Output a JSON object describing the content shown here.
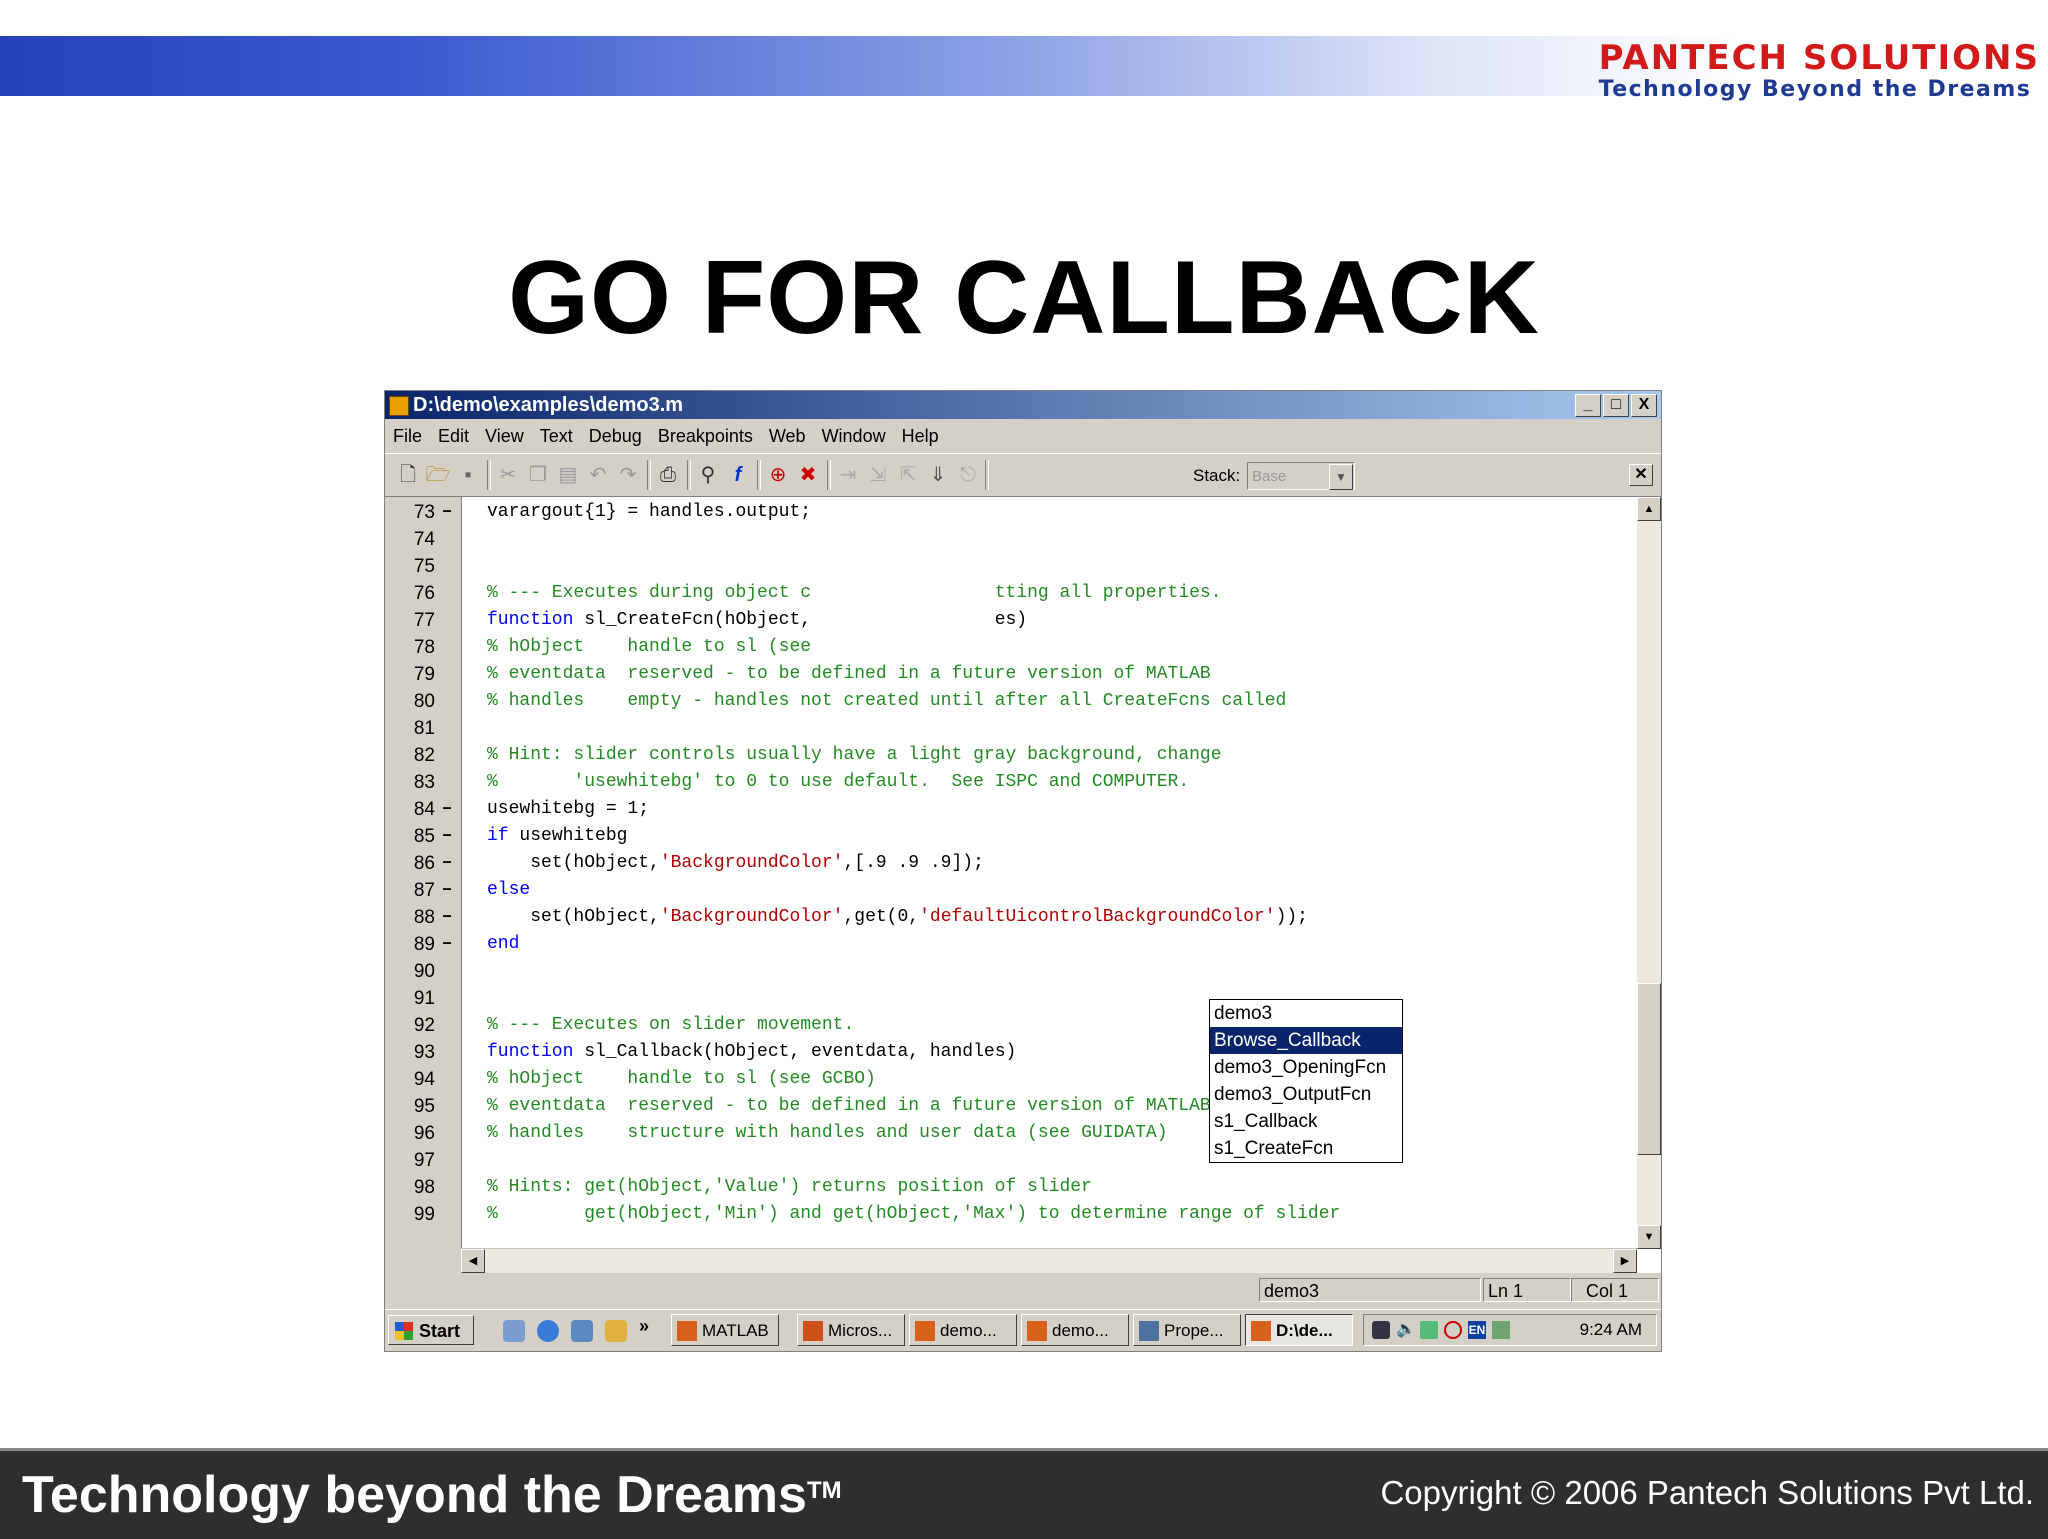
{
  "header": {
    "brand": "PANTECH SOLUTIONS",
    "tagline": "Technology Beyond the Dreams"
  },
  "slide_title": "GO FOR CALLBACK",
  "window": {
    "title": "D:\\demo\\examples\\demo3.m",
    "buttons": [
      "_",
      "□",
      "X"
    ]
  },
  "menu": [
    "File",
    "Edit",
    "View",
    "Text",
    "Debug",
    "Breakpoints",
    "Web",
    "Window",
    "Help"
  ],
  "toolbar": {
    "stack_label": "Stack:",
    "stack_value": "Base",
    "icons": [
      "new-file-icon",
      "open-icon",
      "save-icon",
      "cut-icon",
      "copy-icon",
      "paste-icon",
      "undo-icon",
      "redo-icon",
      "print-icon",
      "find-icon",
      "function-icon",
      "set-breakpoint-icon",
      "clear-breakpoint-icon",
      "step-icon",
      "step-in-icon",
      "step-out-icon",
      "continue-icon",
      "exit-debug-icon"
    ]
  },
  "code_lines": [
    {
      "n": "73",
      "bp": "–",
      "parts": [
        {
          "t": "varargout{1} = handles.output;",
          "c": ""
        }
      ]
    },
    {
      "n": "74",
      "bp": "",
      "parts": []
    },
    {
      "n": "75",
      "bp": "",
      "parts": []
    },
    {
      "n": "76",
      "bp": "",
      "parts": [
        {
          "t": "% --- Executes during object c",
          "c": "cm"
        },
        {
          "t": "                 ",
          "c": ""
        },
        {
          "t": "tting all properties.",
          "c": "cm"
        }
      ]
    },
    {
      "n": "77",
      "bp": "",
      "parts": [
        {
          "t": "function",
          "c": "kw"
        },
        {
          "t": " sl_CreateFcn(hObject,",
          "c": ""
        },
        {
          "t": "                 ",
          "c": ""
        },
        {
          "t": "es)",
          "c": ""
        }
      ]
    },
    {
      "n": "78",
      "bp": "",
      "parts": [
        {
          "t": "% hObject    handle to sl (see",
          "c": "cm"
        }
      ]
    },
    {
      "n": "79",
      "bp": "",
      "parts": [
        {
          "t": "% eventdata  reserved - to be defined in a future version of MATLAB",
          "c": "cm"
        }
      ]
    },
    {
      "n": "80",
      "bp": "",
      "parts": [
        {
          "t": "% handles    empty - handles not created until after all CreateFcns called",
          "c": "cm"
        }
      ]
    },
    {
      "n": "81",
      "bp": "",
      "parts": []
    },
    {
      "n": "82",
      "bp": "",
      "parts": [
        {
          "t": "% Hint: slider controls usually have a light gray background, change",
          "c": "cm"
        }
      ]
    },
    {
      "n": "83",
      "bp": "",
      "parts": [
        {
          "t": "%       'usewhitebg' to 0 to use default.  See ISPC and COMPUTER.",
          "c": "cm"
        }
      ]
    },
    {
      "n": "84",
      "bp": "–",
      "parts": [
        {
          "t": "usewhitebg = 1;",
          "c": ""
        }
      ]
    },
    {
      "n": "85",
      "bp": "–",
      "parts": [
        {
          "t": "if",
          "c": "kw"
        },
        {
          "t": " usewhitebg",
          "c": ""
        }
      ]
    },
    {
      "n": "86",
      "bp": "–",
      "parts": [
        {
          "t": "    set(hObject,",
          "c": ""
        },
        {
          "t": "'BackgroundColor'",
          "c": "str"
        },
        {
          "t": ",[.9 .9 .9]);",
          "c": ""
        }
      ]
    },
    {
      "n": "87",
      "bp": "–",
      "parts": [
        {
          "t": "else",
          "c": "kw"
        }
      ]
    },
    {
      "n": "88",
      "bp": "–",
      "parts": [
        {
          "t": "    set(hObject,",
          "c": ""
        },
        {
          "t": "'BackgroundColor'",
          "c": "str"
        },
        {
          "t": ",get(0,",
          "c": ""
        },
        {
          "t": "'defaultUicontrolBackgroundColor'",
          "c": "str"
        },
        {
          "t": "));",
          "c": ""
        }
      ]
    },
    {
      "n": "89",
      "bp": "–",
      "parts": [
        {
          "t": "end",
          "c": "kw"
        }
      ]
    },
    {
      "n": "90",
      "bp": "",
      "parts": []
    },
    {
      "n": "91",
      "bp": "",
      "parts": []
    },
    {
      "n": "92",
      "bp": "",
      "parts": [
        {
          "t": "% --- Executes on slider movement.",
          "c": "cm"
        }
      ]
    },
    {
      "n": "93",
      "bp": "",
      "parts": [
        {
          "t": "function",
          "c": "kw"
        },
        {
          "t": " sl_Callback(hObject, eventdata, handles)",
          "c": ""
        }
      ]
    },
    {
      "n": "94",
      "bp": "",
      "parts": [
        {
          "t": "% hObject    handle to sl (see GCBO)",
          "c": "cm"
        }
      ]
    },
    {
      "n": "95",
      "bp": "",
      "parts": [
        {
          "t": "% eventdata  reserved - to be defined in a future version of MATLAB",
          "c": "cm"
        }
      ]
    },
    {
      "n": "96",
      "bp": "",
      "parts": [
        {
          "t": "% handles    structure with handles and user data (see GUIDATA)",
          "c": "cm"
        }
      ]
    },
    {
      "n": "97",
      "bp": "",
      "parts": []
    },
    {
      "n": "98",
      "bp": "",
      "parts": [
        {
          "t": "% Hints: get(hObject,'Value') returns position of slider",
          "c": "cm"
        }
      ]
    },
    {
      "n": "99",
      "bp": "",
      "parts": [
        {
          "t": "%        get(hObject,'Min') and get(hObject,'Max') to determine range of slider",
          "c": "cm"
        }
      ]
    }
  ],
  "function_popup": {
    "items": [
      "demo3",
      "Browse_Callback",
      "demo3_OpeningFcn",
      "demo3_OutputFcn",
      "s1_Callback",
      "s1_CreateFcn"
    ],
    "selected": "Browse_Callback"
  },
  "status": {
    "function": "demo3",
    "line": "Ln 1",
    "col": "Col 1"
  },
  "taskbar": {
    "start": "Start",
    "chevron": "»",
    "tasks": [
      {
        "label": "MATLAB",
        "icon": "matlab-icon"
      },
      {
        "label": "Micros...",
        "icon": "powerpoint-icon"
      },
      {
        "label": "demo...",
        "icon": "matlab-icon"
      },
      {
        "label": "demo...",
        "icon": "matlab-icon"
      },
      {
        "label": "Prope...",
        "icon": "property-inspector-icon"
      },
      {
        "label": "D:\\de...",
        "icon": "matlab-editor-icon",
        "active": true
      }
    ],
    "lang": "EN",
    "clock": "9:24 AM"
  },
  "footer": {
    "tagline": "Technology beyond the Dreams",
    "tm": "TM",
    "copyright": "Copyright © 2006 Pantech Solutions Pvt Ltd."
  },
  "colors": {
    "keyword": "#0000ff",
    "comment": "#228b22",
    "string": "#b00000",
    "title_bar": "#0a246a",
    "brand_red": "#d21a1a",
    "brand_blue": "#1f3a93"
  }
}
